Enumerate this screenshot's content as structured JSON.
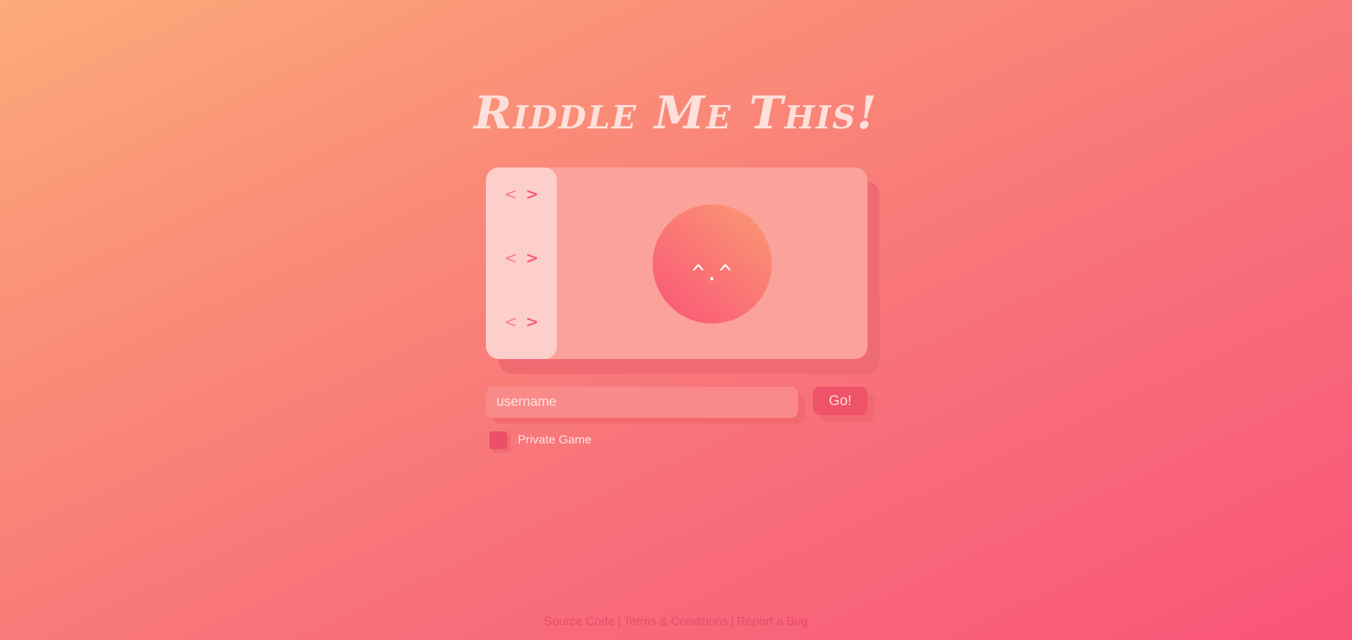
{
  "title": "Riddle Me This!",
  "avatar_selector": {
    "rows": [
      {
        "left": "<",
        "right": ">"
      },
      {
        "left": "<",
        "right": ">"
      },
      {
        "left": "<",
        "right": ">"
      }
    ]
  },
  "avatar": {
    "face": "^.^"
  },
  "join_form": {
    "username_placeholder": "username",
    "username_value": "",
    "go_label": "Go!",
    "private_label": "Private Game"
  },
  "footer": {
    "links": [
      "Source Code",
      "Terms & Conditions",
      "Report a Bug"
    ],
    "separator": "|"
  },
  "colors": {
    "accent": "#ee5369",
    "title": "#fde0da",
    "card": "#fba39b"
  }
}
